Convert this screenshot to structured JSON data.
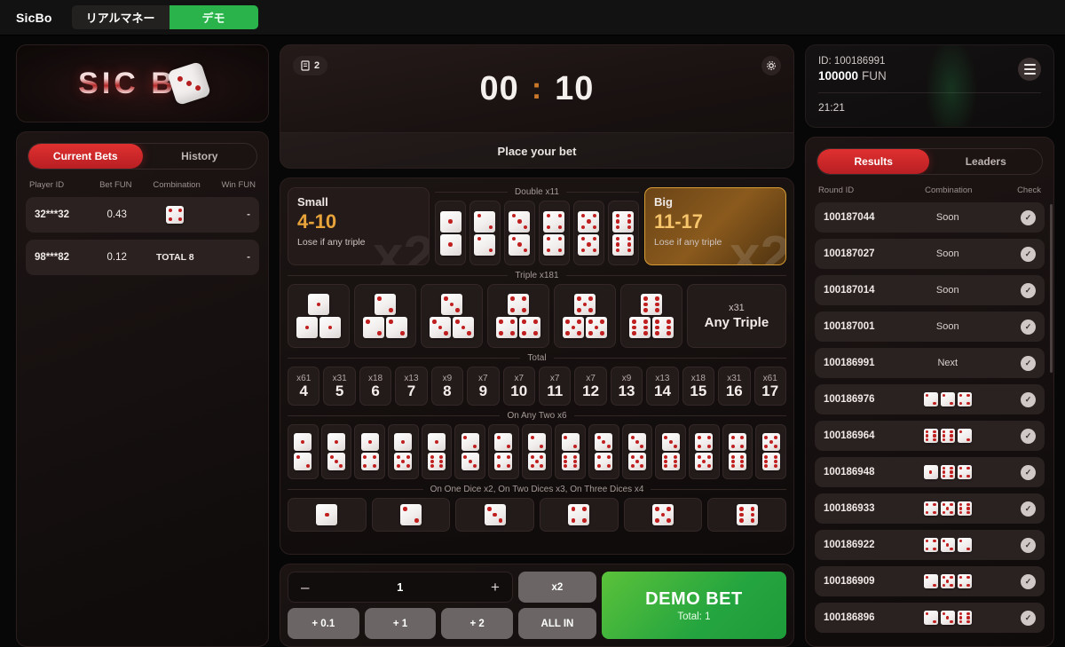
{
  "header": {
    "brand": "SicBo",
    "tabs": [
      {
        "label": "リアルマネー",
        "active": false
      },
      {
        "label": "デモ",
        "active": true
      }
    ],
    "accent_green": "#2bb34b"
  },
  "logo": {
    "text": "SIC B",
    "die_face": 3
  },
  "bets_panel": {
    "tabs": [
      {
        "label": "Current Bets",
        "active": true
      },
      {
        "label": "History",
        "active": false
      }
    ],
    "columns": [
      "Player ID",
      "Bet  FUN",
      "Combination",
      "Win  FUN"
    ],
    "rows": [
      {
        "player": "32***32",
        "bet": "0.43",
        "combination_dice": [
          4
        ],
        "combination_text": "",
        "win": "-"
      },
      {
        "player": "98***82",
        "bet": "0.12",
        "combination_dice": [],
        "combination_text": "TOTAL 8",
        "win": "-"
      }
    ]
  },
  "timer": {
    "badge_count": "2",
    "badge_icon": "receipt-icon",
    "settings_icon": "gear-icon",
    "minutes": "00",
    "separator": ":",
    "seconds": "10",
    "status": "Place your bet",
    "colon_color": "#c9782a"
  },
  "board": {
    "small": {
      "title": "Small",
      "range": "4-10",
      "note": "Lose if any triple",
      "multiplier": "x2",
      "selected": false
    },
    "big": {
      "title": "Big",
      "range": "11-17",
      "note": "Lose if any triple",
      "multiplier": "x2",
      "selected": true,
      "highlight_color": "#d59b35"
    },
    "double": {
      "label": "Double x11",
      "cells": [
        1,
        2,
        3,
        4,
        5,
        6
      ]
    },
    "triple": {
      "label": "Triple x181",
      "cells": [
        1,
        2,
        3,
        4,
        5,
        6
      ],
      "any": {
        "multiplier": "x31",
        "label": "Any Triple"
      }
    },
    "total": {
      "label": "Total",
      "cells": [
        {
          "mult": "x61",
          "num": "4"
        },
        {
          "mult": "x31",
          "num": "5"
        },
        {
          "mult": "x18",
          "num": "6"
        },
        {
          "mult": "x13",
          "num": "7"
        },
        {
          "mult": "x9",
          "num": "8"
        },
        {
          "mult": "x7",
          "num": "9"
        },
        {
          "mult": "x7",
          "num": "10"
        },
        {
          "mult": "x7",
          "num": "11"
        },
        {
          "mult": "x7",
          "num": "12"
        },
        {
          "mult": "x9",
          "num": "13"
        },
        {
          "mult": "x13",
          "num": "14"
        },
        {
          "mult": "x18",
          "num": "15"
        },
        {
          "mult": "x31",
          "num": "16"
        },
        {
          "mult": "x61",
          "num": "17"
        }
      ]
    },
    "on_any_two": {
      "label": "On Any Two x6",
      "pairs": [
        [
          1,
          2
        ],
        [
          1,
          3
        ],
        [
          1,
          4
        ],
        [
          1,
          5
        ],
        [
          1,
          6
        ],
        [
          2,
          3
        ],
        [
          2,
          4
        ],
        [
          2,
          5
        ],
        [
          2,
          6
        ],
        [
          3,
          4
        ],
        [
          3,
          5
        ],
        [
          3,
          6
        ],
        [
          4,
          5
        ],
        [
          4,
          6
        ],
        [
          5,
          6
        ]
      ]
    },
    "single": {
      "label": "On One Dice x2, On Two Dices x3, On Three Dices x4",
      "faces": [
        1,
        2,
        3,
        4,
        5,
        6
      ]
    }
  },
  "betbar": {
    "decrement": "–",
    "amount": "1",
    "increment": "+",
    "double_label": "x2",
    "quick": [
      "+ 0.1",
      "+ 1",
      "+ 2"
    ],
    "allin_label": "ALL IN",
    "submit_label": "DEMO BET",
    "submit_total": "Total: 1",
    "submit_color": "#25a53f"
  },
  "account": {
    "id_label": "ID: 100186991",
    "balance": "100000",
    "currency": "FUN",
    "time": "21:21",
    "menu_icon": "hamburger-icon"
  },
  "results_panel": {
    "tabs": [
      {
        "label": "Results",
        "active": true
      },
      {
        "label": "Leaders",
        "active": false
      }
    ],
    "columns": [
      "Round ID",
      "Combination",
      "Check"
    ],
    "rows": [
      {
        "round_id": "100187044",
        "text": "Soon",
        "dice": []
      },
      {
        "round_id": "100187027",
        "text": "Soon",
        "dice": []
      },
      {
        "round_id": "100187014",
        "text": "Soon",
        "dice": []
      },
      {
        "round_id": "100187001",
        "text": "Soon",
        "dice": []
      },
      {
        "round_id": "100186991",
        "text": "Next",
        "dice": []
      },
      {
        "round_id": "100186976",
        "text": "",
        "dice": [
          2,
          2,
          4
        ]
      },
      {
        "round_id": "100186964",
        "text": "",
        "dice": [
          6,
          6,
          2
        ]
      },
      {
        "round_id": "100186948",
        "text": "",
        "dice": [
          1,
          6,
          4
        ]
      },
      {
        "round_id": "100186933",
        "text": "",
        "dice": [
          4,
          5,
          6
        ]
      },
      {
        "round_id": "100186922",
        "text": "",
        "dice": [
          4,
          3,
          2
        ]
      },
      {
        "round_id": "100186909",
        "text": "",
        "dice": [
          2,
          5,
          4
        ]
      },
      {
        "round_id": "100186896",
        "text": "",
        "dice": [
          2,
          3,
          6
        ]
      }
    ],
    "check_icon": "check-circle-icon"
  }
}
